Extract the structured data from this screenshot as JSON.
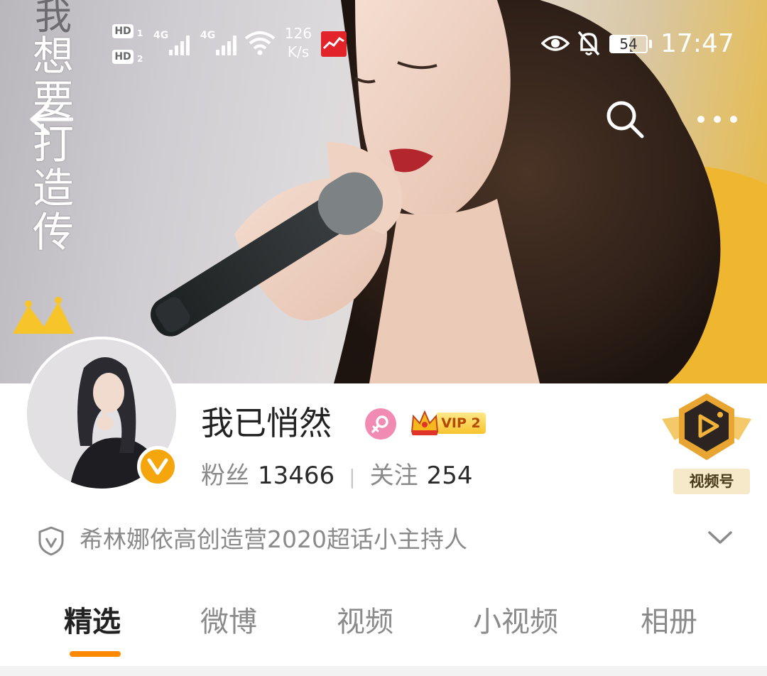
{
  "status_bar": {
    "hd1": "HD",
    "hd1_sub": "1",
    "hd2": "HD",
    "hd2_sub": "2",
    "signal1": "4G",
    "signal2": "4G",
    "net_speed_value": "126",
    "net_speed_unit": "K/s",
    "battery": "54",
    "time": "17:47",
    "icons": [
      "hd-icon",
      "signal-icon",
      "wifi-icon",
      "app-notification-icon",
      "eye-icon",
      "mute-bell-icon",
      "battery-icon"
    ]
  },
  "cover": {
    "handwritten_text": [
      "我",
      "想",
      "要",
      "打",
      "造",
      "传"
    ]
  },
  "nav": {
    "icons": [
      "back-arrow-icon",
      "search-icon",
      "more-icon"
    ]
  },
  "profile": {
    "username": "我已悄然",
    "vip_label": "VIP 2",
    "fans_label": "粉丝",
    "fans_count": "13466",
    "separator": "|",
    "following_label": "关注",
    "following_count": "254",
    "video_badge_label": "视频号",
    "intro": "希林娜依高创造营2020超话小主持人"
  },
  "tabs": [
    {
      "label": "精选",
      "active": true
    },
    {
      "label": "微博",
      "active": false
    },
    {
      "label": "视频",
      "active": false
    },
    {
      "label": "小视频",
      "active": false
    },
    {
      "label": "相册",
      "active": false
    }
  ],
  "colors": {
    "accent": "#ff8a00",
    "verified": "#f5a60c",
    "gender": "#f28bb4",
    "text_muted": "#8a8a8a"
  }
}
